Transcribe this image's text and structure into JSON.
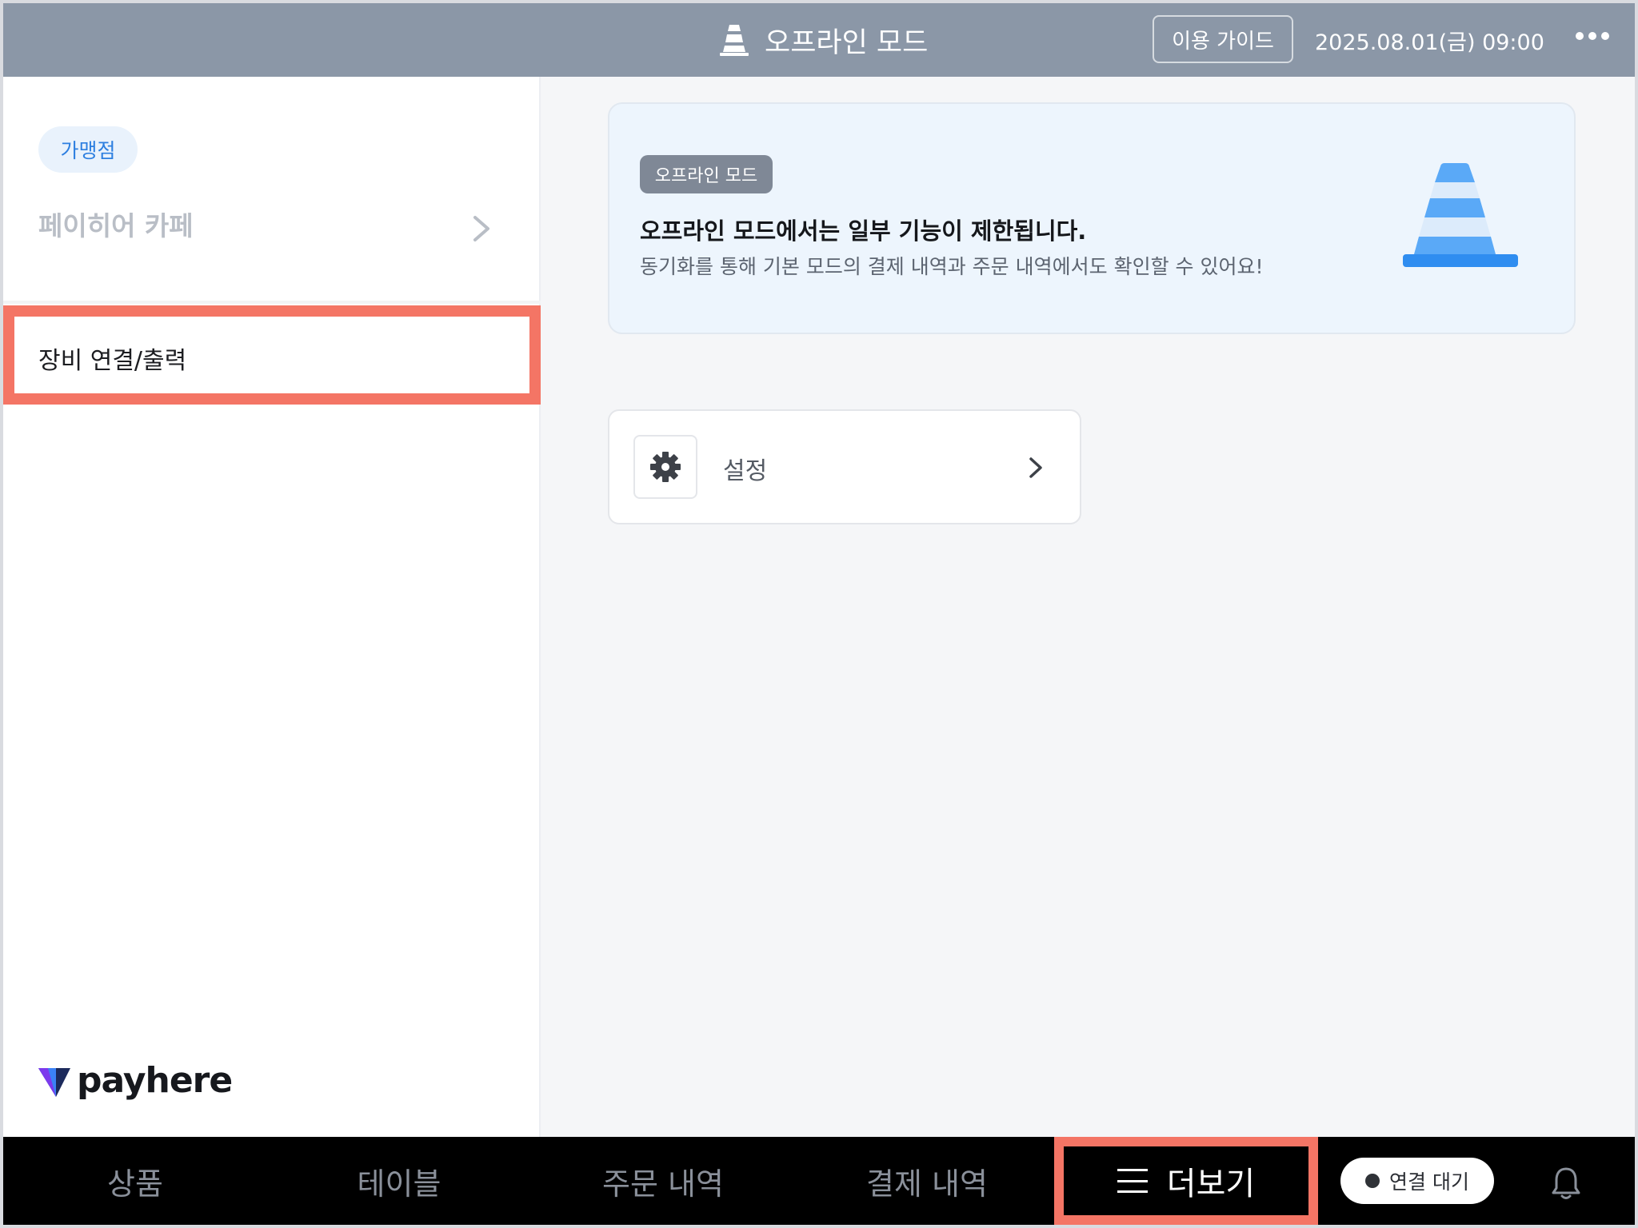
{
  "header": {
    "title": "오프라인 모드",
    "guide_label": "이용 가이드",
    "datetime": "2025.08.01(금) 09:00"
  },
  "sidebar": {
    "store_chip": "가맹점",
    "store_name": "페이히어 카페",
    "menu_item": "장비 연결/출력",
    "logo": "payhere"
  },
  "banner": {
    "badge": "오프라인 모드",
    "title": "오프라인 모드에서는 일부 기능이 제한됩니다.",
    "description": "동기화를 통해 기본 모드의 결제 내역과 주문 내역에서도 확인할 수 있어요!"
  },
  "settings": {
    "label": "설정"
  },
  "bottom_nav": {
    "items": [
      "상품",
      "테이블",
      "주문 내역",
      "결제 내역",
      "더보기"
    ],
    "connection_status": "연결 대기"
  },
  "colors": {
    "topbar": "#8b97a7",
    "highlight": "#f47565",
    "accent": "#2d7fe0"
  }
}
